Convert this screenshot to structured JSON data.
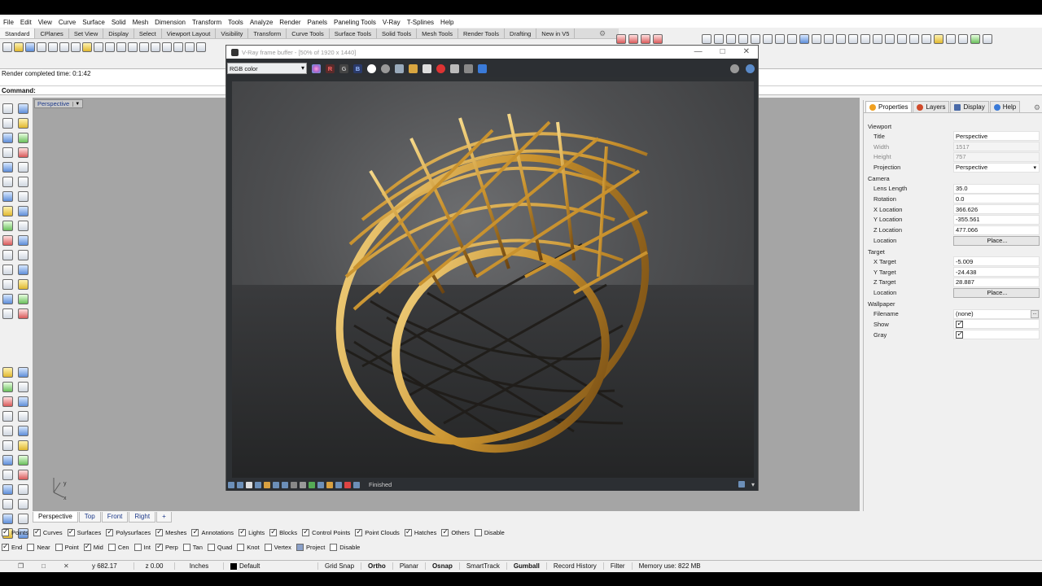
{
  "menu": [
    "File",
    "Edit",
    "View",
    "Curve",
    "Surface",
    "Solid",
    "Mesh",
    "Dimension",
    "Transform",
    "Tools",
    "Analyze",
    "Render",
    "Panels",
    "Paneling Tools",
    "V-Ray",
    "T-Splines",
    "Help"
  ],
  "toolbar_tabs": [
    "Standard",
    "CPlanes",
    "Set View",
    "Display",
    "Select",
    "Viewport Layout",
    "Visibility",
    "Transform",
    "Curve Tools",
    "Surface Tools",
    "Solid Tools",
    "Mesh Tools",
    "Render Tools",
    "Drafting",
    "New in V5"
  ],
  "command": {
    "history_line": "Render completed time: 0:1:42",
    "prompt": "Command:"
  },
  "viewport": {
    "label": "Perspective",
    "axis_y": "y",
    "axis_x": "x"
  },
  "viewport_tabs": [
    "Perspective",
    "Top",
    "Front",
    "Right"
  ],
  "filters": [
    {
      "label": "Points",
      "checked": true
    },
    {
      "label": "Curves",
      "checked": true
    },
    {
      "label": "Surfaces",
      "checked": true
    },
    {
      "label": "Polysurfaces",
      "checked": true
    },
    {
      "label": "Meshes",
      "checked": true
    },
    {
      "label": "Annotations",
      "checked": true
    },
    {
      "label": "Lights",
      "checked": true
    },
    {
      "label": "Blocks",
      "checked": true
    },
    {
      "label": "Control Points",
      "checked": true
    },
    {
      "label": "Point Clouds",
      "checked": true
    },
    {
      "label": "Hatches",
      "checked": true
    },
    {
      "label": "Others",
      "checked": true
    },
    {
      "label": "Disable",
      "checked": false
    }
  ],
  "osnaps": [
    {
      "label": "End",
      "checked": true
    },
    {
      "label": "Near",
      "checked": false
    },
    {
      "label": "Point",
      "checked": false
    },
    {
      "label": "Mid",
      "checked": true
    },
    {
      "label": "Cen",
      "checked": false
    },
    {
      "label": "Int",
      "checked": false
    },
    {
      "label": "Perp",
      "checked": true
    },
    {
      "label": "Tan",
      "checked": false
    },
    {
      "label": "Quad",
      "checked": false
    },
    {
      "label": "Knot",
      "checked": false
    },
    {
      "label": "Vertex",
      "checked": false
    },
    {
      "label": "Project",
      "checked": false
    },
    {
      "label": "Disable",
      "checked": false
    }
  ],
  "status": {
    "y": "y 682.17",
    "z": "z 0.00",
    "units": "Inches",
    "layer": "Default",
    "grid_snap": "Grid Snap",
    "ortho": "Ortho",
    "planar": "Planar",
    "osnap": "Osnap",
    "smarttrack": "SmartTrack",
    "gumball": "Gumball",
    "record_history": "Record History",
    "filter": "Filter",
    "memory": "Memory use: 822 MB"
  },
  "vfb": {
    "title": "V-Ray frame buffer - [50% of 1920 x 1440]",
    "channel": "RGB color",
    "btn_r": "R",
    "btn_g": "G",
    "btn_b": "B",
    "status_text": "Finished"
  },
  "panel": {
    "tabs": [
      "Properties",
      "Layers",
      "Display",
      "Help"
    ],
    "viewport_section": "Viewport",
    "title_k": "Title",
    "title_v": "Perspective",
    "width_k": "Width",
    "width_v": "1517",
    "height_k": "Height",
    "height_v": "757",
    "projection_k": "Projection",
    "projection_v": "Perspective",
    "camera_section": "Camera",
    "lens_k": "Lens Length",
    "lens_v": "35.0",
    "rotation_k": "Rotation",
    "rotation_v": "0.0",
    "xloc_k": "X Location",
    "xloc_v": "366.626",
    "yloc_k": "Y Location",
    "yloc_v": "-355.561",
    "zloc_k": "Z Location",
    "zloc_v": "477.066",
    "loc_k": "Location",
    "place": "Place...",
    "target_section": "Target",
    "xt_k": "X Target",
    "xt_v": "-5.009",
    "yt_k": "Y Target",
    "yt_v": "-24.438",
    "zt_k": "Z Target",
    "zt_v": "28.887",
    "tloc_k": "Location",
    "wallpaper_section": "Wallpaper",
    "filename_k": "Filename",
    "filename_v": "(none)",
    "show_k": "Show",
    "gray_k": "Gray"
  }
}
